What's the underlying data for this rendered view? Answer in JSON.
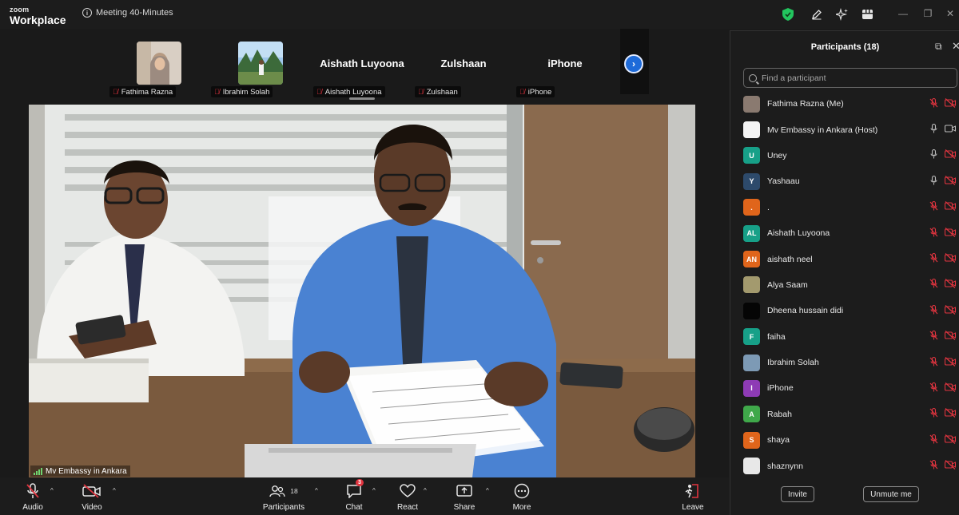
{
  "app": {
    "logo_line1": "zoom",
    "logo_line2": "Workplace",
    "meeting_title": "Meeting 40-Minutes"
  },
  "titlebar_icons": [
    "shield-check-icon",
    "pencil-icon",
    "sparkle-icon",
    "apps-icon",
    "minimize-icon",
    "restore-icon",
    "close-icon"
  ],
  "strip": {
    "thumbnails": [
      {
        "name": "Fathima Razna",
        "display": "photo"
      },
      {
        "name": "Ibrahim Solah",
        "display": "photo"
      },
      {
        "name": "Aishath Luyoona",
        "display": "name",
        "big": "Aishath Luyoona"
      },
      {
        "name": "Zulshaan",
        "display": "name",
        "big": "Zulshaan"
      },
      {
        "name": "iPhone",
        "display": "name",
        "big": "iPhone"
      }
    ]
  },
  "video": {
    "speaker_label": "Mv Embassy in Ankara"
  },
  "panel": {
    "title": "Participants (18)",
    "search_placeholder": "Find a participant",
    "invite_label": "Invite",
    "unmute_label": "Unmute me",
    "participants": [
      {
        "name": "Fathima Razna (Me)",
        "initials": "",
        "avatar_color": "#8a7a70",
        "mic": "off",
        "cam": "off"
      },
      {
        "name": "Mv Embassy in Ankara (Host)",
        "initials": "",
        "avatar_color": "#f4f4f4",
        "mic": "on",
        "cam": "on"
      },
      {
        "name": "Uney",
        "initials": "U",
        "avatar_color": "#17a088",
        "mic": "on",
        "cam": "off"
      },
      {
        "name": "Yashaau",
        "initials": "Y",
        "avatar_color": "#2d4a6b",
        "mic": "on",
        "cam": "off"
      },
      {
        "name": ".",
        "initials": ".",
        "avatar_color": "#e0651b",
        "mic": "off",
        "cam": "off"
      },
      {
        "name": "Aishath Luyoona",
        "initials": "AL",
        "avatar_color": "#17a088",
        "mic": "off",
        "cam": "off"
      },
      {
        "name": "aishath neel",
        "initials": "AN",
        "avatar_color": "#e0651b",
        "mic": "off",
        "cam": "off"
      },
      {
        "name": "Alya Saam",
        "initials": "",
        "avatar_color": "#a39a6e",
        "mic": "off",
        "cam": "off"
      },
      {
        "name": "Dheena hussain didi",
        "initials": "",
        "avatar_color": "#050505",
        "mic": "off",
        "cam": "off"
      },
      {
        "name": "faiha",
        "initials": "F",
        "avatar_color": "#17a088",
        "mic": "off",
        "cam": "off"
      },
      {
        "name": "Ibrahim Solah",
        "initials": "",
        "avatar_color": "#7d9ab5",
        "mic": "off",
        "cam": "off"
      },
      {
        "name": "iPhone",
        "initials": "I",
        "avatar_color": "#8e3bb5",
        "mic": "off",
        "cam": "off"
      },
      {
        "name": "Rabah",
        "initials": "A",
        "avatar_color": "#3fa84a",
        "mic": "off",
        "cam": "off"
      },
      {
        "name": "shaya",
        "initials": "S",
        "avatar_color": "#e0651b",
        "mic": "off",
        "cam": "off"
      },
      {
        "name": "shaznynn",
        "initials": "",
        "avatar_color": "#e8e8e8",
        "mic": "off",
        "cam": "off"
      }
    ]
  },
  "toolbar": {
    "audio": "Audio",
    "video": "Video",
    "participants": "Participants",
    "participants_count": "18",
    "chat": "Chat",
    "chat_badge": "3",
    "react": "React",
    "share": "Share",
    "more": "More",
    "leave": "Leave"
  },
  "colors": {
    "accent": "#1e6bd9",
    "muted_red": "#e0343f",
    "shield_green": "#22c55e"
  }
}
